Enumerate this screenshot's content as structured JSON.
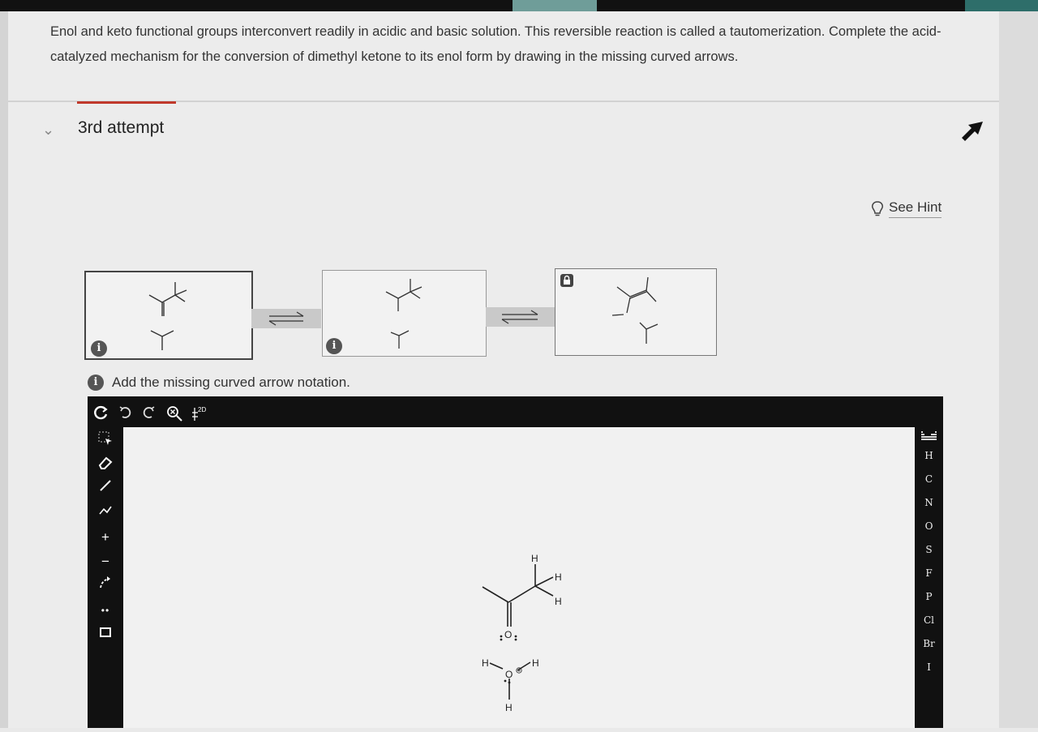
{
  "question": {
    "text": "Enol and keto functional groups interconvert readily in acidic and basic solution. This reversible reaction is called a tautomerization. Complete the acid-catalyzed mechanism for the conversion of dimethyl ketone to its enol form by drawing in the missing curved arrows."
  },
  "attempt": {
    "title": "3rd attempt"
  },
  "hint": {
    "label": "See Hint"
  },
  "mechanism": {
    "instruction": "Add the missing curved arrow notation.",
    "info_badge": "i",
    "atom_labels": {
      "hydrogen": "H",
      "oxygen": "O"
    }
  },
  "editor": {
    "top_tools": [
      "clear-icon",
      "undo-icon",
      "redo-icon",
      "zoom-icon",
      "2d-clean-icon"
    ],
    "clean_label": "2D",
    "left_tools": [
      "select-icon",
      "eraser-icon",
      "bond-icon",
      "chain-icon",
      "plus-charge-icon",
      "minus-charge-icon",
      "curved-arrow-icon",
      "lone-pair-icon",
      "box-icon"
    ],
    "left_glyphs": {
      "plus": "+",
      "minus": "−",
      "lone_pair": "••"
    },
    "elements": [
      "H",
      "C",
      "N",
      "O",
      "S",
      "F",
      "P",
      "Cl",
      "Br",
      "I"
    ],
    "canvas_labels": {
      "h_top": "H",
      "h_right": "H",
      "h_right2": "H",
      "o_carbonyl": "O",
      "h_left": "H",
      "o_hydronium": "O",
      "h_hydronium_right": "H",
      "h_bottom": "H"
    }
  }
}
